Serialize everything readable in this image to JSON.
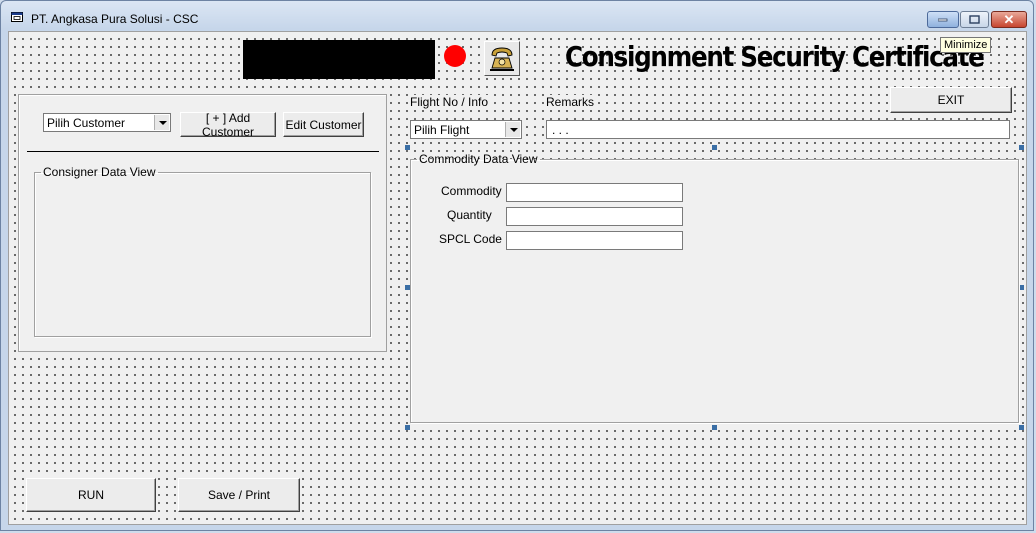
{
  "window": {
    "title": "PT. Angkasa Pura Solusi - CSC",
    "tooltip": "Minimize",
    "controls": [
      "minimize-icon",
      "maximize-icon",
      "close-icon"
    ]
  },
  "header": {
    "title": "Consignment Security Certificate",
    "status_color": "#ff0000",
    "phone_icon": "telephone-icon"
  },
  "customer": {
    "select_value": "Pilih Customer",
    "add_label": "[ + ] Add Customer",
    "edit_label": "Edit Customer",
    "consigner_legend": "Consigner Data View"
  },
  "flight": {
    "label": "Flight No / Info",
    "select_value": "Pilih Flight"
  },
  "remarks": {
    "label": "Remarks",
    "value": ". . ."
  },
  "exit_label": "EXIT",
  "commodity": {
    "legend": "Commodity Data View",
    "commodity_label": "Commodity",
    "quantity_label": "Quantity",
    "spcl_label": "SPCL Code",
    "commodity_value": "",
    "quantity_value": "",
    "spcl_value": ""
  },
  "footer": {
    "run_label": "RUN",
    "save_label": "Save / Print"
  }
}
